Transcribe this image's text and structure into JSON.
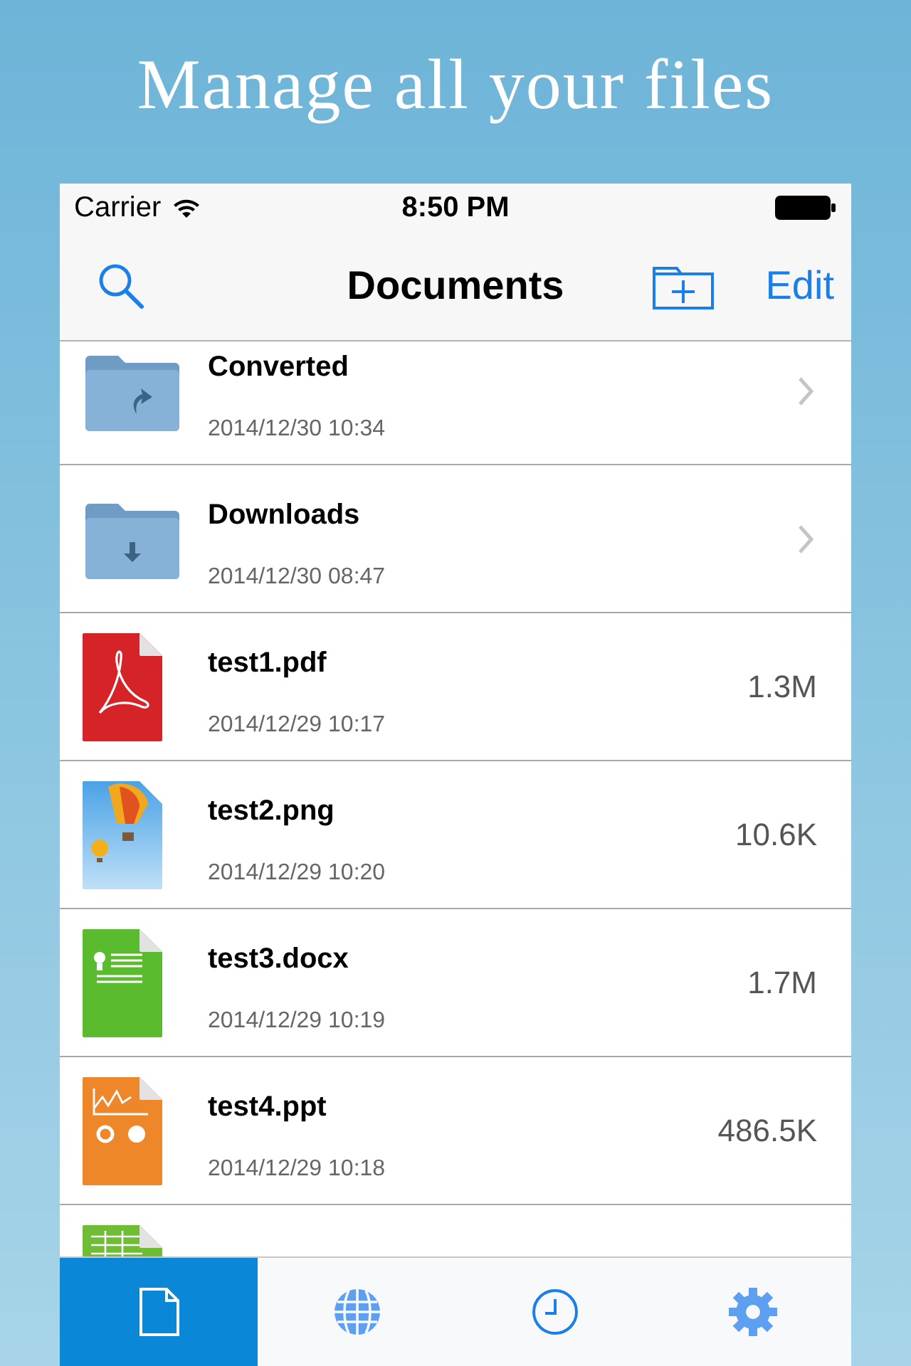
{
  "headline": "Manage all your files",
  "status_bar": {
    "carrier": "Carrier",
    "time": "8:50 PM"
  },
  "nav_bar": {
    "title": "Documents",
    "edit": "Edit"
  },
  "files": [
    {
      "kind": "folder",
      "name": "Converted",
      "date": "2014/12/30 10:34"
    },
    {
      "kind": "folder",
      "name": "Downloads",
      "date": "2014/12/30 08:47"
    },
    {
      "kind": "pdf",
      "name": "test1.pdf",
      "date": "2014/12/29 10:17",
      "size": "1.3M"
    },
    {
      "kind": "image",
      "name": "test2.png",
      "date": "2014/12/29 10:20",
      "size": "10.6K"
    },
    {
      "kind": "doc",
      "name": "test3.docx",
      "date": "2014/12/29 10:19",
      "size": "1.7M"
    },
    {
      "kind": "ppt",
      "name": "test4.ppt",
      "date": "2014/12/29 10:18",
      "size": "486.5K"
    },
    {
      "kind": "sheet"
    }
  ],
  "tabs": [
    {
      "selected": true
    },
    {
      "selected": false
    },
    {
      "selected": false
    },
    {
      "selected": false
    }
  ]
}
